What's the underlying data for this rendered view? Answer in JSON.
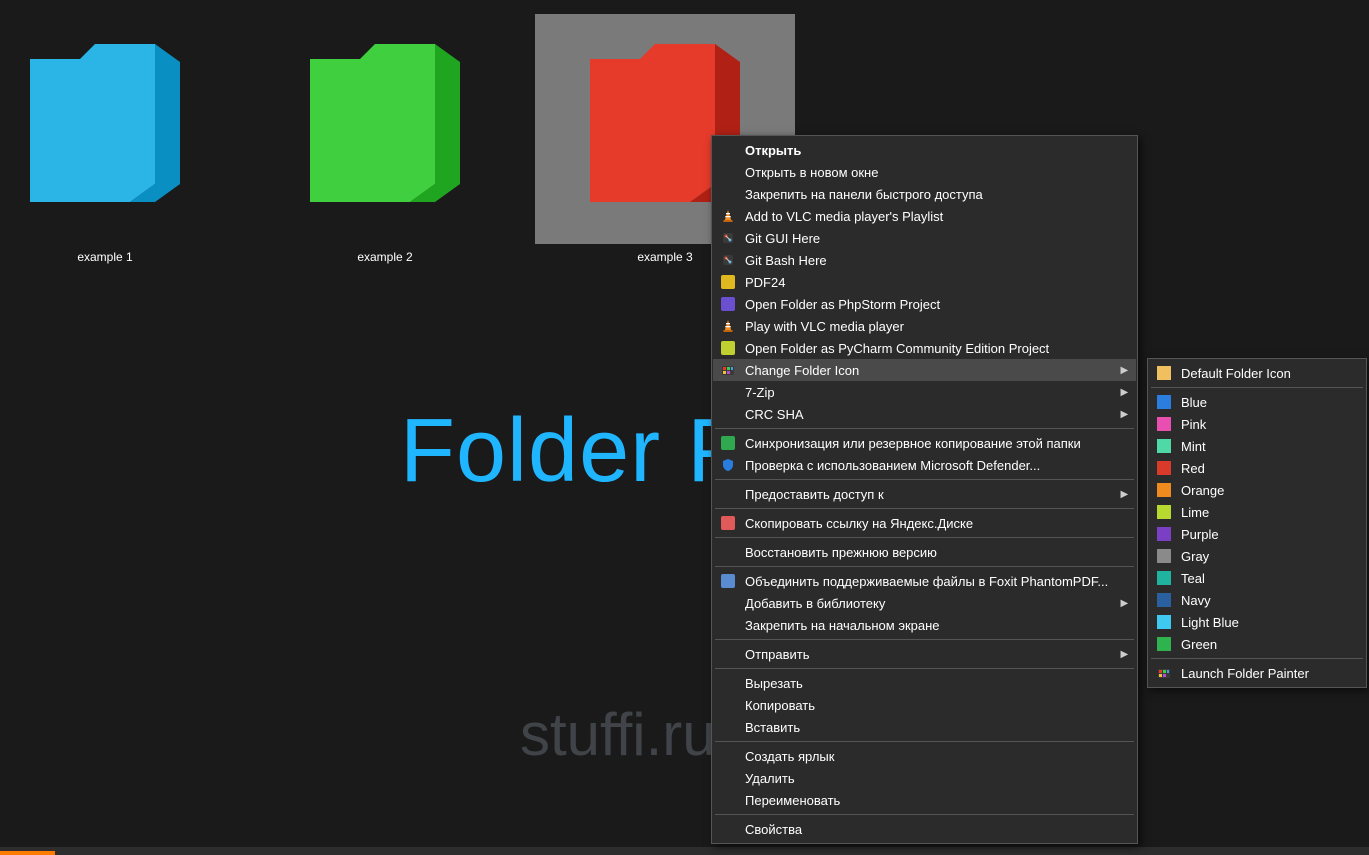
{
  "watermark_title": "Folder Painter",
  "watermark_site": "stuffi.ru",
  "folders": [
    {
      "label": "example 1",
      "color_light": "#2bb4e6",
      "color_dark": "#0a8fc2",
      "selected": false
    },
    {
      "label": "example 2",
      "color_light": "#3fcf3f",
      "color_dark": "#1fa51f",
      "selected": false
    },
    {
      "label": "example 3",
      "color_light": "#e63a2a",
      "color_dark": "#b02015",
      "selected": true
    }
  ],
  "context_menu": {
    "items": [
      {
        "label": "Открыть",
        "bold": true
      },
      {
        "label": "Открыть в новом окне"
      },
      {
        "label": "Закрепить на панели быстрого доступа"
      },
      {
        "label": "Add to VLC media player's Playlist",
        "icon": "vlc"
      },
      {
        "label": "Git GUI Here",
        "icon": "git"
      },
      {
        "label": "Git Bash Here",
        "icon": "git"
      },
      {
        "label": "PDF24",
        "icon": "pdf24"
      },
      {
        "label": "Open Folder as PhpStorm Project",
        "icon": "phpstorm"
      },
      {
        "label": "Play with VLC media player",
        "icon": "vlc"
      },
      {
        "label": "Open Folder as PyCharm Community Edition Project",
        "icon": "pycharm"
      },
      {
        "label": "Change Folder Icon",
        "icon": "painter",
        "submenu": true,
        "highlight": true
      },
      {
        "label": "7-Zip",
        "submenu": true
      },
      {
        "label": "CRC SHA",
        "submenu": true
      },
      {
        "sep": true
      },
      {
        "label": "Синхронизация или резервное копирование этой папки",
        "icon": "gdrive"
      },
      {
        "label": "Проверка с использованием Microsoft Defender...",
        "icon": "defender"
      },
      {
        "sep": true
      },
      {
        "label": "Предоставить доступ к",
        "submenu": true
      },
      {
        "sep": true
      },
      {
        "label": "Скопировать ссылку на Яндекс.Диске",
        "icon": "yadisk"
      },
      {
        "sep": true
      },
      {
        "label": "Восстановить прежнюю версию"
      },
      {
        "sep": true
      },
      {
        "label": "Объединить поддерживаемые файлы в Foxit PhantomPDF...",
        "icon": "foxit"
      },
      {
        "label": "Добавить в библиотеку",
        "submenu": true
      },
      {
        "label": "Закрепить на начальном экране"
      },
      {
        "sep": true
      },
      {
        "label": "Отправить",
        "submenu": true
      },
      {
        "sep": true
      },
      {
        "label": "Вырезать"
      },
      {
        "label": "Копировать"
      },
      {
        "label": "Вставить"
      },
      {
        "sep": true
      },
      {
        "label": "Создать ярлык"
      },
      {
        "label": "Удалить"
      },
      {
        "label": "Переименовать"
      },
      {
        "sep": true
      },
      {
        "label": "Свойства"
      }
    ]
  },
  "submenu": {
    "items": [
      {
        "label": "Default Folder Icon",
        "swatch": "#f0c060",
        "type": "folder"
      },
      {
        "sep": true
      },
      {
        "label": "Blue",
        "swatch": "#2b7de0"
      },
      {
        "label": "Pink",
        "swatch": "#e84fb0"
      },
      {
        "label": "Mint",
        "swatch": "#4fd9a6"
      },
      {
        "label": "Red",
        "swatch": "#d93a2a"
      },
      {
        "label": "Orange",
        "swatch": "#ef8a1f"
      },
      {
        "label": "Lime",
        "swatch": "#b7d930"
      },
      {
        "label": "Purple",
        "swatch": "#7a3fc2"
      },
      {
        "label": "Gray",
        "swatch": "#8a8a8a"
      },
      {
        "label": "Teal",
        "swatch": "#1fb3a0"
      },
      {
        "label": "Navy",
        "swatch": "#2a5fa0"
      },
      {
        "label": "Light Blue",
        "swatch": "#3fc9f0"
      },
      {
        "label": "Green",
        "swatch": "#2fb34f"
      },
      {
        "sep": true
      },
      {
        "label": "Launch Folder Painter",
        "icon": "painter"
      }
    ]
  },
  "icons": {
    "vlc": "#f08a1f",
    "git": "#5a8ad0",
    "pdf24": "#e0b820",
    "phpstorm": "#6a4fd0",
    "pycharm": "#c0d030",
    "painter": "#e060a0",
    "gdrive": "#2fa84f",
    "defender": "#2a7de0",
    "yadisk": "#e05a5a",
    "foxit": "#5a8ad0"
  }
}
